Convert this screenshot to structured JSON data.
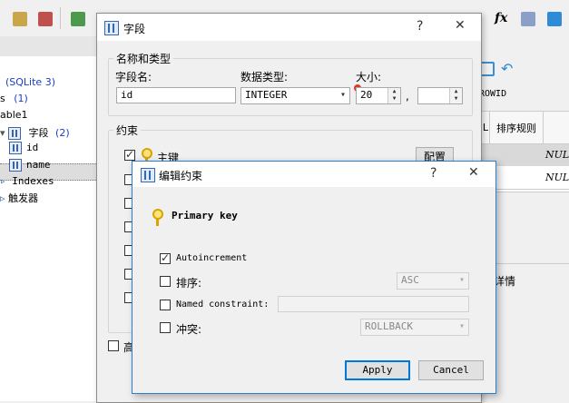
{
  "background": {
    "tree": {
      "db_label": "(SQLite 3)",
      "tables_prefix": "s",
      "tables_count": "(1)",
      "table_name": "able1",
      "fields_label": "字段",
      "fields_count": "(2)",
      "field1": "id",
      "field2": "name",
      "indexes": "Indexes",
      "triggers": "触发器"
    },
    "right_panel": {
      "rowid_label": "ROWID",
      "col_header_l": "L",
      "col_header_sort": "排序规则",
      "null1": "NULL",
      "null2": "NULL",
      "details": "详情"
    },
    "toolbar_text": {
      "fx": "fx"
    }
  },
  "field_dialog": {
    "title": "字段",
    "help": "?",
    "close": "✕",
    "name_type_group": "名称和类型",
    "field_name_label": "字段名:",
    "field_name_value": "id",
    "data_type_label": "数据类型:",
    "data_type_value": "INTEGER",
    "size_label": "大小:",
    "size_value": "20",
    "size_separator": ",",
    "size2_value": "",
    "constraints_group": "约束",
    "primary_key_label": "主键",
    "configure_button": "配置",
    "advanced_label": "高"
  },
  "constraint_dialog": {
    "title": "编辑约束",
    "help": "?",
    "close": "✕",
    "header": "Primary key",
    "autoincrement_label": "Autoincrement",
    "autoincrement_checked": true,
    "sort_label": "排序:",
    "sort_value": "ASC",
    "named_constraint_label": "Named constraint:",
    "named_constraint_value": "",
    "conflict_label": "冲突:",
    "conflict_value": "ROLLBACK",
    "apply_button": "Apply",
    "cancel_button": "Cancel"
  }
}
